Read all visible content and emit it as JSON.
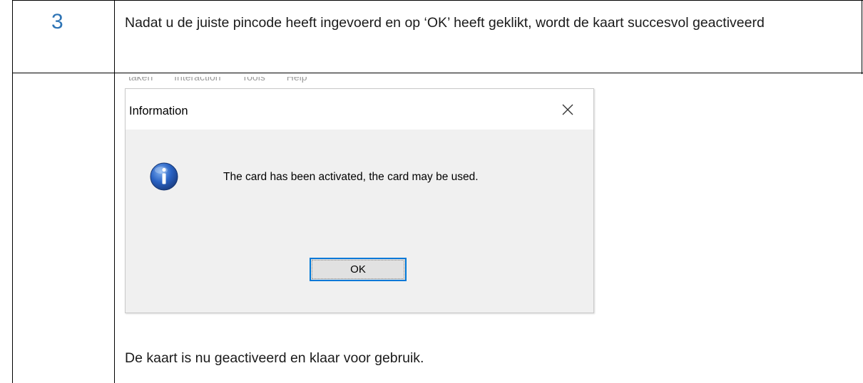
{
  "step": {
    "number": "3"
  },
  "instruction": "Nadat u de juiste pincode heeft ingevoerd en op ‘OK’ heeft geklikt, wordt de kaart succesvol geactiveerd",
  "background_menu_text": "taken   Interaction   Tools   Help",
  "dialog": {
    "title": "Information",
    "close_icon": "close-icon",
    "icon": "info-icon",
    "message": "The card has been activated, the card may be used.",
    "ok_label": "OK"
  },
  "caption": "De kaart is nu geactiveerd en klaar voor gebruik.",
  "colors": {
    "step_number": "#2e74b5",
    "dialog_background": "#f0f0f0",
    "focus_border": "#0078d7",
    "info_icon": "#1f4f9e"
  }
}
